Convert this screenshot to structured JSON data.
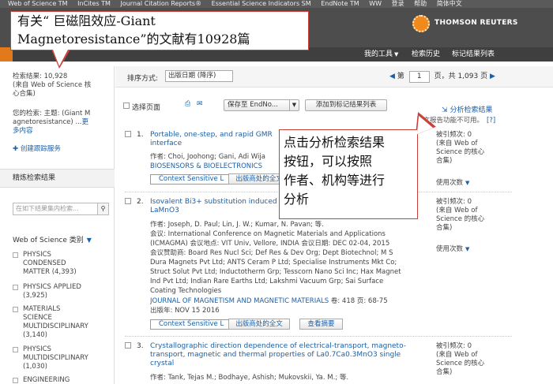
{
  "topbar": {
    "items": [
      "Web of Science TM",
      "InCites TM",
      "Journal Citation Reports®",
      "Essential Science Indicators SM",
      "EndNote TM",
      "WW",
      "登录",
      "帮助",
      "简体中文"
    ]
  },
  "brand": {
    "name": "THOMSON REUTERS"
  },
  "nav": {
    "my_tools": "我的工具",
    "search_history": "检索历史",
    "marked_list": "标记结果列表"
  },
  "callout_top": {
    "line1": "有关“ 巨磁阻效应-Giant",
    "line2": "Magnetoresistance”的文献有10928篇"
  },
  "callout_right": {
    "line1": "点击分析检索结果",
    "line2": "按钮，可以按照",
    "line3": "作者、机构等进行",
    "line4": "分析"
  },
  "sidebar": {
    "results_line1": "检索结果: 10,928",
    "results_line2": "(来自 Web of Science 核",
    "results_line3": "心合集)",
    "query_line1": "您的检索: 主题: (Giant M",
    "query_line2": "agnetoresistance) ...",
    "query_more": "更",
    "query_more2": "多内容",
    "create_alert": "创建跟踪服务",
    "refine_heading": "精炼检索结果",
    "refine_placeholder": "在如下结果集内检索...",
    "wos_categories_heading": "Web of Science 类别",
    "categories": [
      {
        "line1": "PHYSICS",
        "line2": "CONDENSED",
        "line3": "MATTER (4,393)"
      },
      {
        "line1": "PHYSICS APPLIED",
        "line2": "(3,925)",
        "line3": ""
      },
      {
        "line1": "MATERIALS",
        "line2": "SCIENCE",
        "line3": "MULTIDISCIPLINARY",
        "line4": "(3,140)"
      },
      {
        "line1": "PHYSICS",
        "line2": "MULTIDISCIPLINARY",
        "line3": "(1,030)"
      },
      {
        "line1": "ENGINEERING"
      }
    ]
  },
  "sortbar": {
    "sort_label": "排序方式:",
    "sort_value": "出版日期 (降序)",
    "page_prefix": "第",
    "page_value": "1",
    "page_suffix": "页，共",
    "total_pages": "1,093",
    "page_unit": "页"
  },
  "actions": {
    "select_page": "选择页面",
    "save_to": "保存至 EndNo...",
    "add_to_marked": "添加到标记结果列表",
    "analyze_results": "分析检索结果",
    "cite_report_note": "引文报告功能不可用。",
    "cite_report_help": "[?]"
  },
  "records": [
    {
      "num": "1.",
      "title_line1": "Portable, one-step, and rapid GMR",
      "title_line2": "interface",
      "authors": "作者: Choi, Joohong; Gani, Adi Wija",
      "journal": "BIOSENSORS & BIOELECTRONICS",
      "context_link": "Context Sensitive L",
      "fulltext": "出版商处的全文",
      "cited": "被引频次: 0",
      "cited_src1": "(来自 Web of",
      "cited_src2": "Science 的核心",
      "cited_src3": "合集)",
      "usage": "使用次数"
    },
    {
      "num": "2.",
      "title_line1": "Isovalent Bi3+ substitution induced",
      "title_line2": "LaMnO3",
      "authors": "作者: Joseph, D. Paul; Lin, J. W.; Kumar, N. Pavan; 等.",
      "conf1": "会议: International Conference on Magnetic Materials and Applications",
      "conf2": "(ICMAGMA) 会议地点: VIT Univ, Vellore, INDIA 会议日期: DEC 02-04, 2015",
      "conf3": "会议赞助商: Board Res Nucl Sci; Def Res & Dev Org; Dept Biotechnol; M S",
      "conf4": "Dura Magnets Pvt Ltd; ANTS Ceram P Ltd; Specialise Instruments Mkt Co;",
      "conf5": "Struct Solut Pvt Ltd; Inductotherm Grp; Tesscorn Nano Sci Inc; Hax Magnet",
      "conf6": "Ind Pvt Ltd; Indian Rare Earths Ltd; Lakshmi Vacuum Grp; Sai Surface",
      "conf7": "Coating Technologies",
      "journal": "JOURNAL OF MAGNETISM AND MAGNETIC MATERIALS",
      "vol_pages": "卷: 418  页: 68-75",
      "pub_date": "出版年: NOV 15 2016",
      "context_link": "Context Sensitive L",
      "fulltext": "出版商处的全文",
      "abstract": "查看摘要",
      "cited": "被引频次: 0",
      "cited_src1": "(来自 Web of",
      "cited_src2": "Science 的核心",
      "cited_src3": "合集)",
      "usage": "使用次数"
    },
    {
      "num": "3.",
      "title_line1": "Crystallographic direction dependence of electrical-transport, magneto-",
      "title_line2": "transport, magnetic and thermal properties of La0.7Ca0.3MnO3 single",
      "title_line3": "crystal",
      "authors": "作者: Tank, Tejas M.; Bodhaye, Ashish; Mukovskii, Ya. M.; 等.",
      "cited": "被引频次: 0",
      "cited_src1": "(来自 Web of",
      "cited_src2": "Science 的核心",
      "cited_src3": "合集)"
    }
  ]
}
